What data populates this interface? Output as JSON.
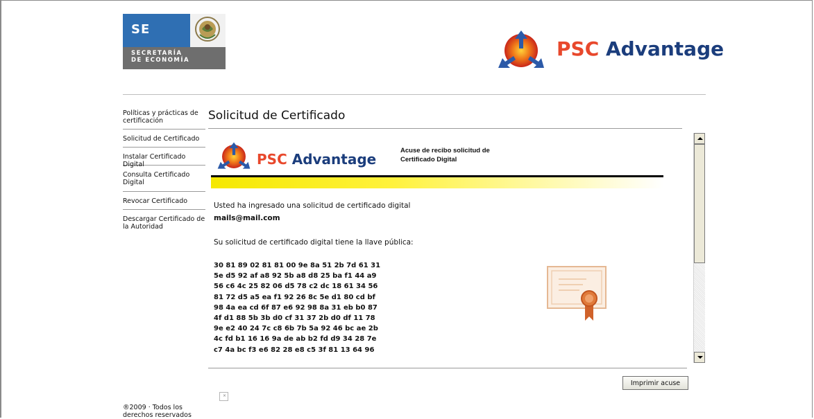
{
  "header": {
    "se_logo": {
      "abbrev": "SE",
      "subtitle_line1": "SECRETARÍA",
      "subtitle_line2": "DE ECONOMÍA",
      "icon": "mexico-seal-icon"
    },
    "psc_logo": {
      "word1": "PSC",
      "word2": "Advantage",
      "icon": "psc-triangle-logo-icon"
    }
  },
  "sidebar": {
    "items": [
      {
        "label": "Políticas y prácticas de certificación"
      },
      {
        "label": "Solicitud de Certificado"
      },
      {
        "label": "Instalar Certificado Digital"
      },
      {
        "label": "Consulta Certificado Digital"
      },
      {
        "label": "Revocar Certificado"
      },
      {
        "label": "Descargar Certificado de la Autoridad"
      }
    ],
    "copyright": "®2009 · Todos los derechos reservados"
  },
  "main": {
    "title": "Solicitud de Certificado",
    "receipt": {
      "logo_word1": "PSC",
      "logo_word2": "Advantage",
      "title_line1": "Acuse de recibo solicitud de",
      "title_line2": "Certificado Digital",
      "intro": "Usted ha ingresado una solicitud de certificado digital",
      "email": "mails@mail.com",
      "key_label": "Su solicitud de certificado digital tiene la llave pública:",
      "key_lines": [
        "30 81 89 02 81 81 00 9e 8a 51 2b 7d 61 31",
        "5e d5 92 af a8 92 5b a8 d8 25 ba f1 44 a9",
        "56 c6 4c 25 82 06 d5 78 c2 dc 18 61 34 56",
        "81 72 d5 a5 ea f1 92 26 8c 5e d1 80 cd bf",
        "98 4a ea cd 6f 87 e6 92 98 8a 31 eb b0 87",
        "4f d1 88 5b 3b d0 cf 31 37 2b d0 df 11 78",
        "9e e2 40 24 7c c8 6b 7b 5a 92 46 bc ae 2b",
        "4c fd b1 16 16 9a de ab b2 fd d9 34 28 7e",
        "c7 4a bc f3 e6 82 28 e8 c5 3f 81 13 64 96"
      ],
      "cert_icon": "certificate-icon"
    },
    "print_button": "Imprimir acuse"
  },
  "colors": {
    "psc_red": "#e8482c",
    "psc_blue": "#1b3d7c",
    "se_blue": "#2f6fb3",
    "se_grey": "#6e6e6e"
  }
}
